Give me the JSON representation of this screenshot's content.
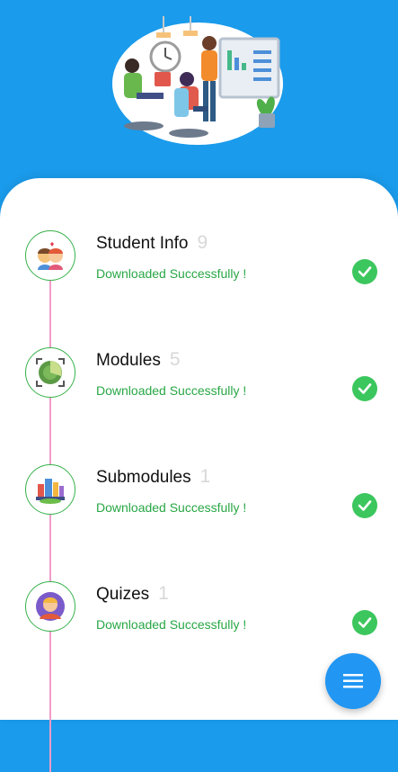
{
  "colors": {
    "header_bg": "#1A9BEB",
    "accent_green": "#28A745",
    "timeline_pink": "#F19CC8",
    "fab_blue": "#2196F3"
  },
  "items": [
    {
      "title": "Student Info",
      "count": "9",
      "status": "Downloaded Successfully !",
      "icon": "students-icon"
    },
    {
      "title": "Modules",
      "count": "5",
      "status": "Downloaded Successfully !",
      "icon": "target-icon"
    },
    {
      "title": "Submodules",
      "count": "1",
      "status": "Downloaded Successfully !",
      "icon": "city-icon"
    },
    {
      "title": "Quizes",
      "count": "1",
      "status": "Downloaded Successfully !",
      "icon": "avatar-icon"
    }
  ],
  "fab": {
    "icon": "menu-icon"
  }
}
